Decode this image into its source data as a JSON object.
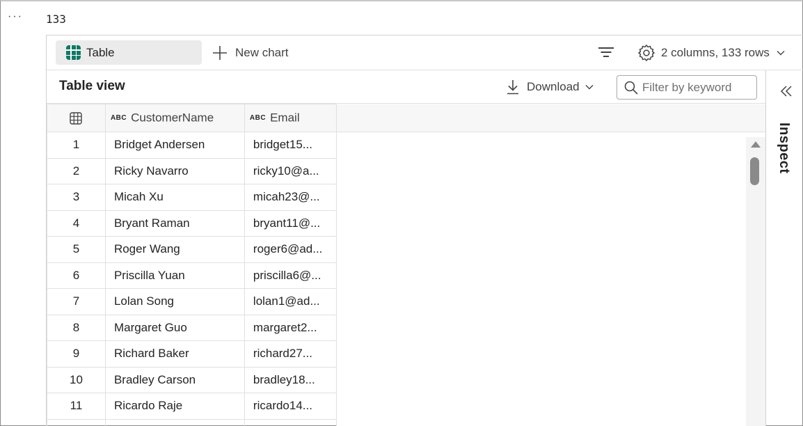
{
  "cell": {
    "more_label": "···",
    "output_value": "133"
  },
  "toolbar": {
    "table_tab_label": "Table",
    "new_chart_label": "New chart",
    "settings_label": "2 columns, 133 rows"
  },
  "view": {
    "title": "Table view",
    "download_label": "Download",
    "filter_placeholder": "Filter by keyword"
  },
  "table": {
    "type_badge": "ABC",
    "columns": [
      "CustomerName",
      "Email"
    ],
    "rows": [
      {
        "index": "1",
        "name": "Bridget Andersen",
        "email": "bridget15..."
      },
      {
        "index": "2",
        "name": "Ricky Navarro",
        "email": "ricky10@a..."
      },
      {
        "index": "3",
        "name": "Micah Xu",
        "email": "micah23@..."
      },
      {
        "index": "4",
        "name": "Bryant Raman",
        "email": "bryant11@..."
      },
      {
        "index": "5",
        "name": "Roger Wang",
        "email": "roger6@ad..."
      },
      {
        "index": "6",
        "name": "Priscilla Yuan",
        "email": "priscilla6@..."
      },
      {
        "index": "7",
        "name": "Lolan Song",
        "email": "lolan1@ad..."
      },
      {
        "index": "8",
        "name": "Margaret Guo",
        "email": "margaret2..."
      },
      {
        "index": "9",
        "name": "Richard Baker",
        "email": "richard27..."
      },
      {
        "index": "10",
        "name": "Bradley Carson",
        "email": "bradley18..."
      },
      {
        "index": "11",
        "name": "Ricardo Raje",
        "email": "ricardo14..."
      },
      {
        "index": "",
        "name": "",
        "email": ""
      }
    ]
  },
  "inspect": {
    "label": "Inspect"
  },
  "icons": {
    "table_tab": "table-grid-icon",
    "new_chart": "plus-icon",
    "filter": "filter-lines-icon",
    "settings": "gear-icon",
    "download": "download-icon",
    "search": "search-icon",
    "index_header": "table-icon",
    "collapse": "double-chevron-left-icon"
  },
  "colors": {
    "accent_green": "#117865",
    "tab_bg": "#ebebeb",
    "border": "#e0e0e0"
  }
}
